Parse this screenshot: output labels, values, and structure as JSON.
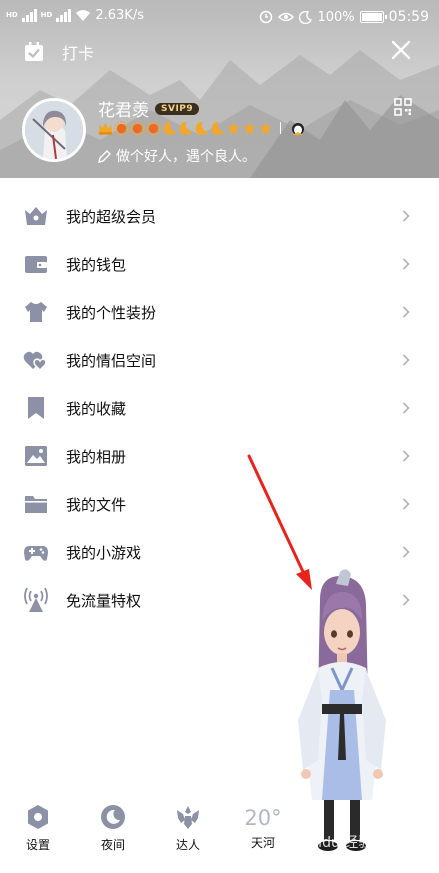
{
  "status_bar": {
    "network_speed": "2.63K/s",
    "battery": "100%",
    "time": "05:59",
    "hd_1": "HD",
    "hd_2": "HD"
  },
  "header": {
    "checkin_label": "打卡",
    "username": "花君羡",
    "vip_badge": "SVIP9",
    "signature": "做个好人，遇个良人。"
  },
  "menu": {
    "items": [
      {
        "label": "我的超级会员",
        "icon": "crown-icon"
      },
      {
        "label": "我的钱包",
        "icon": "wallet-icon"
      },
      {
        "label": "我的个性装扮",
        "icon": "shirt-icon"
      },
      {
        "label": "我的情侣空间",
        "icon": "hearts-icon"
      },
      {
        "label": "我的收藏",
        "icon": "bookmark-icon"
      },
      {
        "label": "我的相册",
        "icon": "picture-icon"
      },
      {
        "label": "我的文件",
        "icon": "folder-icon"
      },
      {
        "label": "我的小游戏",
        "icon": "gamepad-icon"
      },
      {
        "label": "免流量特权",
        "icon": "signal-tower-icon"
      }
    ]
  },
  "bottom_bar": {
    "settings_label": "设置",
    "night_label": "夜间",
    "expert_label": "达人",
    "weather_temp": "20°",
    "weather_city": "天河"
  },
  "watermark": "Baidu 经验",
  "colors": {
    "icon_gray": "#8d91a6",
    "header_bg": "#c6c6c6",
    "arrow_red": "#e8231c"
  }
}
